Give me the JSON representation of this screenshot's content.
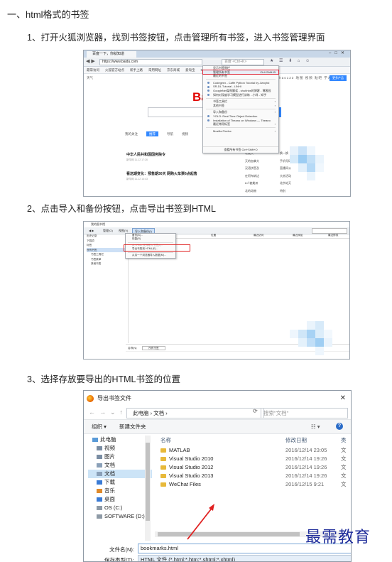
{
  "heading": "一、html格式的书签",
  "steps": [
    "1、打开火狐浏览器，找到书签按钮，点击管理所有书签，进入书签管理界面",
    "2、点击导入和备份按钮，点击导出书签到HTML",
    "3、选择存放要导出的HTML书签的位置"
  ],
  "shot1": {
    "tab": "百度一下，你就知道",
    "url": "https://www.baidu.com",
    "search_placeholder": "百度 <Ctrl+K>",
    "bookmark_bar": [
      "最常访问",
      "火狐官方站点",
      "新手上路",
      "常用网址",
      "京东商城",
      "爱淘宝",
      "Outlook",
      "百度",
      "YUM",
      "新浪微博"
    ],
    "nav_left": "天气",
    "nav_right": "新闻   hao123   地图   视频   贴吧   学术   登录   设置",
    "nav_button": "更多产品",
    "logo": "Bai",
    "feed_tabs": [
      "我的关注",
      "推荐",
      "导航",
      "视频"
    ],
    "news": [
      {
        "title": "中华人民共和国国务院令",
        "sub": "新华网  11-12 17:26"
      },
      {
        "title": "看这期变化：预售期30天 网购火车票6点起售",
        "sub": "新华网  11-12 14:43"
      }
    ],
    "right_list_a": [
      "收藏夹",
      "天的加拿大",
      "汉语拼音及",
      "在阿布纳达",
      "8人被美洲",
      "北的动物",
      "北海岸"
    ],
    "right_list_b": [
      "换一换",
      "手机号码查",
      "直播间公",
      "大房活动",
      "北京站天",
      "特别",
      "的"
    ],
    "menu_items": [
      {
        "label": "显示书签侧栏",
        "type": "plain"
      },
      {
        "label": "管理所有书签",
        "type": "hl",
        "shortcut": "Ctrl+Shift+B"
      },
      {
        "label": "最近的书签",
        "type": "plain"
      },
      {
        "label": "",
        "type": "sep"
      },
      {
        "label": "Codegeex - Caffe Python Tutorial by Jianyhd",
        "type": "dot"
      },
      {
        "label": "SR-DL Tutorial - LINHI",
        "type": "dot"
      },
      {
        "label": "GoogleNet架构解读 - shuhhbs的博客 - 博客园",
        "type": "dot"
      },
      {
        "label": "如何对深度学习模型进行训练 - 小样 - 知乎",
        "type": "dot"
      },
      {
        "label": "",
        "type": "sep"
      },
      {
        "label": "书签工具栏",
        "type": "arrow"
      },
      {
        "label": "其他书签",
        "type": "arrow"
      },
      {
        "label": "",
        "type": "sep"
      },
      {
        "label": "导入和备份",
        "type": "arrow"
      },
      {
        "label": "YOLO: Real-Time Object Detection",
        "type": "dot"
      },
      {
        "label": "Installation of Theano on Windows — Theano",
        "type": "dot"
      },
      {
        "label": "最近常用标签",
        "type": "arrow"
      },
      {
        "label": "",
        "type": "sep"
      },
      {
        "label": "Mozilla Firefox",
        "type": "arrow"
      }
    ],
    "menu_footer": "查看所有书签      Ctrl+Shift+O"
  },
  "shot2": {
    "title": "我的图书馆",
    "toolbar": [
      "管理(O)",
      "视图(V)",
      "导入和备份(I)"
    ],
    "tree": [
      "历史记录",
      "下载项",
      "标签",
      "所有书签",
      "书签工具栏",
      "书签菜单",
      "其他书签"
    ],
    "cols": [
      "名称",
      "标签",
      "位置",
      "最近访问",
      "最近添加",
      "最近修改"
    ],
    "menu": [
      {
        "label": "备份(B)...",
        "state": "on"
      },
      {
        "label": "恢复(R)",
        "state": "on"
      },
      {
        "label": "",
        "state": "sep"
      },
      {
        "label": "从 HTML 文件导入书签(I)...",
        "state": "dis"
      },
      {
        "label": "导出书签到 HTML(E)...",
        "state": "on"
      },
      {
        "label": "",
        "state": "sep"
      },
      {
        "label": "从另一个浏览器导入数据(M)...",
        "state": "on"
      }
    ],
    "detail_name_label": "名称(N):",
    "detail_name": "所有书签"
  },
  "shot3": {
    "title": "导出书签文件",
    "path": "此电脑  ›  文档  ›",
    "search": "搜索\"文档\"",
    "organize": "组织 ▾",
    "new_folder": "新建文件夹",
    "help": "?",
    "sidebar": [
      {
        "label": "此电脑",
        "icon": "computer-icon",
        "sel": false
      },
      {
        "label": "视频",
        "icon": "video-icon",
        "sel": false
      },
      {
        "label": "图片",
        "icon": "picture-icon",
        "sel": false
      },
      {
        "label": "文档",
        "icon": "document-icon",
        "sel": false
      },
      {
        "label": "文档",
        "icon": "document-icon",
        "sel": true
      },
      {
        "label": "下载",
        "icon": "download-icon",
        "sel": false
      },
      {
        "label": "音乐",
        "icon": "music-icon",
        "sel": false
      },
      {
        "label": "桌面",
        "icon": "desktop-icon",
        "sel": false
      },
      {
        "label": "OS (C:)",
        "icon": "drive-icon",
        "sel": false
      },
      {
        "label": "SOFTWARE (D:)",
        "icon": "drive-icon",
        "sel": false
      }
    ],
    "columns": [
      "名称",
      "修改日期",
      "类"
    ],
    "files": [
      {
        "name": "MATLAB",
        "date": "2016/12/14 23:05",
        "kind": "文"
      },
      {
        "name": "Visual Studio 2010",
        "date": "2016/12/14 19:26",
        "kind": "文"
      },
      {
        "name": "Visual Studio 2012",
        "date": "2016/12/14 19:26",
        "kind": "文"
      },
      {
        "name": "Visual Studio 2013",
        "date": "2016/12/14 19:26",
        "kind": "文"
      },
      {
        "name": "WeChat Files",
        "date": "2016/12/15 9:21",
        "kind": "文"
      }
    ],
    "filename_label": "文件名(N):",
    "filename": "bookmarks.html",
    "filetype_label": "保存类型(T):",
    "filetype": "HTML 文件 (*.html;*.htm;*.shtml;*.xhtml)"
  },
  "watermark": "最需教育",
  "colors": {
    "accent": "#3388ff",
    "logo_red": "#e10602",
    "highlight": "#e02020"
  }
}
